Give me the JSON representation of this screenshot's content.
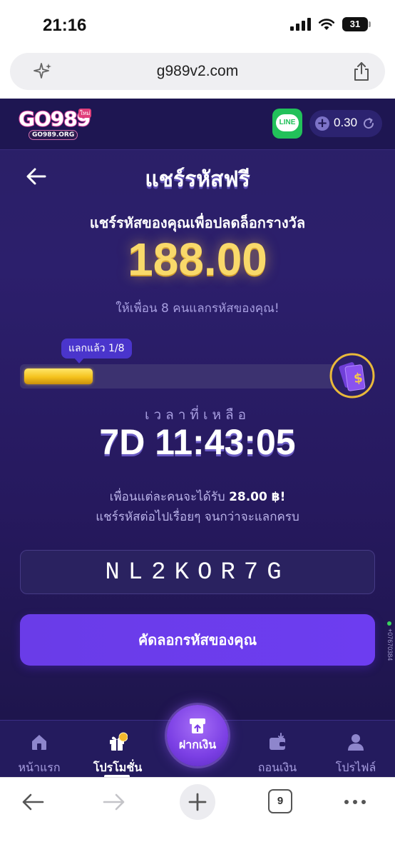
{
  "status": {
    "time": "21:16",
    "battery": "31"
  },
  "browser": {
    "url": "g989v2.com",
    "tab_count": "9"
  },
  "header": {
    "logo_text": "GO989",
    "logo_sub": "GO989.ORG",
    "logo_badge": "ใหม่",
    "line_label": "LINE",
    "balance": "0.30"
  },
  "page": {
    "title": "แชร์รหัสฟรี",
    "subtitle": "แชร์รหัสของคุณเพื่อปลดล็อกรางวัล",
    "amount": "188.00",
    "invite_text": "ให้เพื่อน 8 คนแลกรหัสของคุณ!",
    "progress_label": "แลกแล้ว 1/8",
    "progress_fraction": 0.125,
    "time_label": "เวลาที่เหลือ",
    "time_value": "7D 11:43:05",
    "friend_prefix": "เพื่อนแต่ละคนจะได้รับ",
    "friend_amount": "28.00 ฿!",
    "share_note": "แชร์รหัสต่อไปเรื่อยๆ จนกว่าจะแลกครบ",
    "code": "NL2KOR7G",
    "copy_button": "คัดลอกรหัสของคุณ"
  },
  "nav": {
    "home": "หน้าแรก",
    "promo": "โปรโมชั่น",
    "deposit": "ฝากเงิน",
    "withdraw": "ถอนเงิน",
    "profile": "โปรไฟล์"
  },
  "side_id": "+07670384",
  "colors": {
    "accent": "#6d3df0",
    "gold": "#f9d96a",
    "bg": "#2a1f66"
  }
}
